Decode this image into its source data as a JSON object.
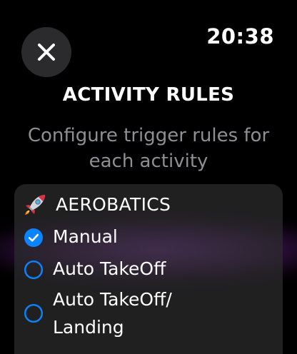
{
  "status_bar": {
    "time": "20:38"
  },
  "header": {
    "close_icon": "close-icon",
    "title": "ACTIVITY RULES",
    "subtitle": "Configure trigger rules for each activity"
  },
  "activity": {
    "icon": "rocket-icon",
    "name": "AEROBATICS",
    "options": [
      {
        "label": "Manual",
        "selected": true
      },
      {
        "label": "Auto TakeOff",
        "selected": false
      },
      {
        "label": "Auto TakeOff/ Landing",
        "selected": false
      }
    ]
  },
  "colors": {
    "accent": "#0a84ff",
    "secondary_text": "#8e8e93",
    "card_background": "#2c2c2e",
    "glow": "#8e3cb4"
  }
}
